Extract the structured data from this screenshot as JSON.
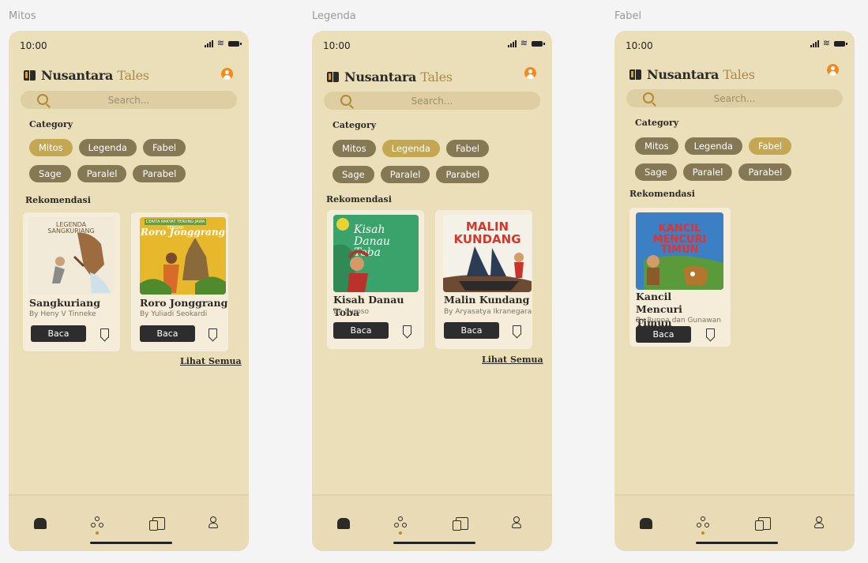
{
  "frames": [
    {
      "label": "Mitos",
      "status_time": "10:00",
      "app_title_1": "Nusantara",
      "app_title_2": "Tales",
      "search_placeholder": "Search...",
      "category_title": "Category",
      "categories": [
        "Mitos",
        "Legenda",
        "Fabel",
        "Sage",
        "Paralel",
        "Parabel"
      ],
      "active_category": "Mitos",
      "recommend_title": "Rekomendasi",
      "books": [
        {
          "title": "Sangkuriang",
          "author": "By Heny V Tinneke",
          "cover_text": "LEGENDA SANGKURIANG",
          "read_label": "Baca"
        },
        {
          "title": "Roro Jonggrang",
          "author": "By Yuliadi Seokardi",
          "cover_text": "Roro Jonggrang",
          "cover_banner": "CERITA RAKYAT TERUNG JAWA TENGAH",
          "read_label": "Baca"
        }
      ],
      "see_all": "Lihat Semua"
    },
    {
      "label": "Legenda",
      "status_time": "10:00",
      "app_title_1": "Nusantara",
      "app_title_2": "Tales",
      "search_placeholder": "Search...",
      "category_title": "Category",
      "categories": [
        "Mitos",
        "Legenda",
        "Fabel",
        "Sage",
        "Paralel",
        "Parabel"
      ],
      "active_category": "Legenda",
      "recommend_title": "Rekomendasi",
      "books": [
        {
          "title": "Kisah Danau Toba",
          "author": "By Suroso",
          "cover_text": "Kisah Danau Toba",
          "read_label": "Baca"
        },
        {
          "title": "Malin Kundang",
          "author": "By Aryasatya Ikranegara",
          "cover_text": "MALIN KUNDANG",
          "read_label": "Baca"
        }
      ],
      "see_all": "Lihat Semua"
    },
    {
      "label": "Fabel",
      "status_time": "10:00",
      "app_title_1": "Nusantara",
      "app_title_2": "Tales",
      "search_placeholder": "Search...",
      "category_title": "Category",
      "categories": [
        "Mitos",
        "Legenda",
        "Fabel",
        "Sage",
        "Paralel",
        "Parabel"
      ],
      "active_category": "Fabel",
      "recommend_title": "Rekomendasi",
      "books": [
        {
          "title": "Kancil Mencuri Timun",
          "author": "By Runna dan Gunawan",
          "cover_text": "KANCIL MENCURI TIMUN",
          "read_label": "Baca"
        }
      ],
      "see_all": ""
    }
  ],
  "colors": {
    "phone_bg": "#ebdfba",
    "chip": "#857854",
    "chip_active": "#c3a753",
    "accent": "#f28a1c",
    "button": "#2d2d2d"
  },
  "icons": [
    "book-icon",
    "avatar-icon",
    "search-icon",
    "bookmark-icon",
    "home-icon",
    "explore-icon",
    "library-icon",
    "profile-icon"
  ]
}
